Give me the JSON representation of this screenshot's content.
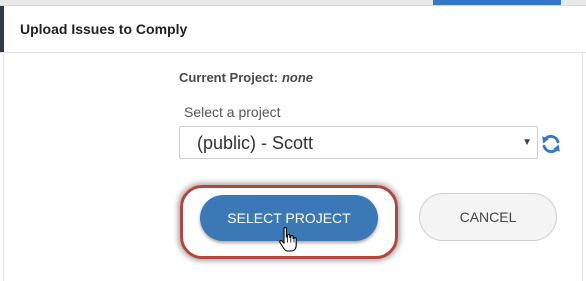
{
  "dialog": {
    "title": "Upload Issues to Comply"
  },
  "current_project": {
    "label": "Current Project:",
    "value": "none"
  },
  "project_select": {
    "label": "Select a project",
    "selected_value": "(public) - Scott",
    "caret": "▼",
    "refresh_icon": "refresh-icon"
  },
  "buttons": {
    "select_project": "SELECT PROJECT",
    "cancel": "CANCEL"
  },
  "colors": {
    "primary_button": "#3a79b6",
    "highlight_ring": "#b5453a",
    "refresh_icon": "#3277c9"
  }
}
